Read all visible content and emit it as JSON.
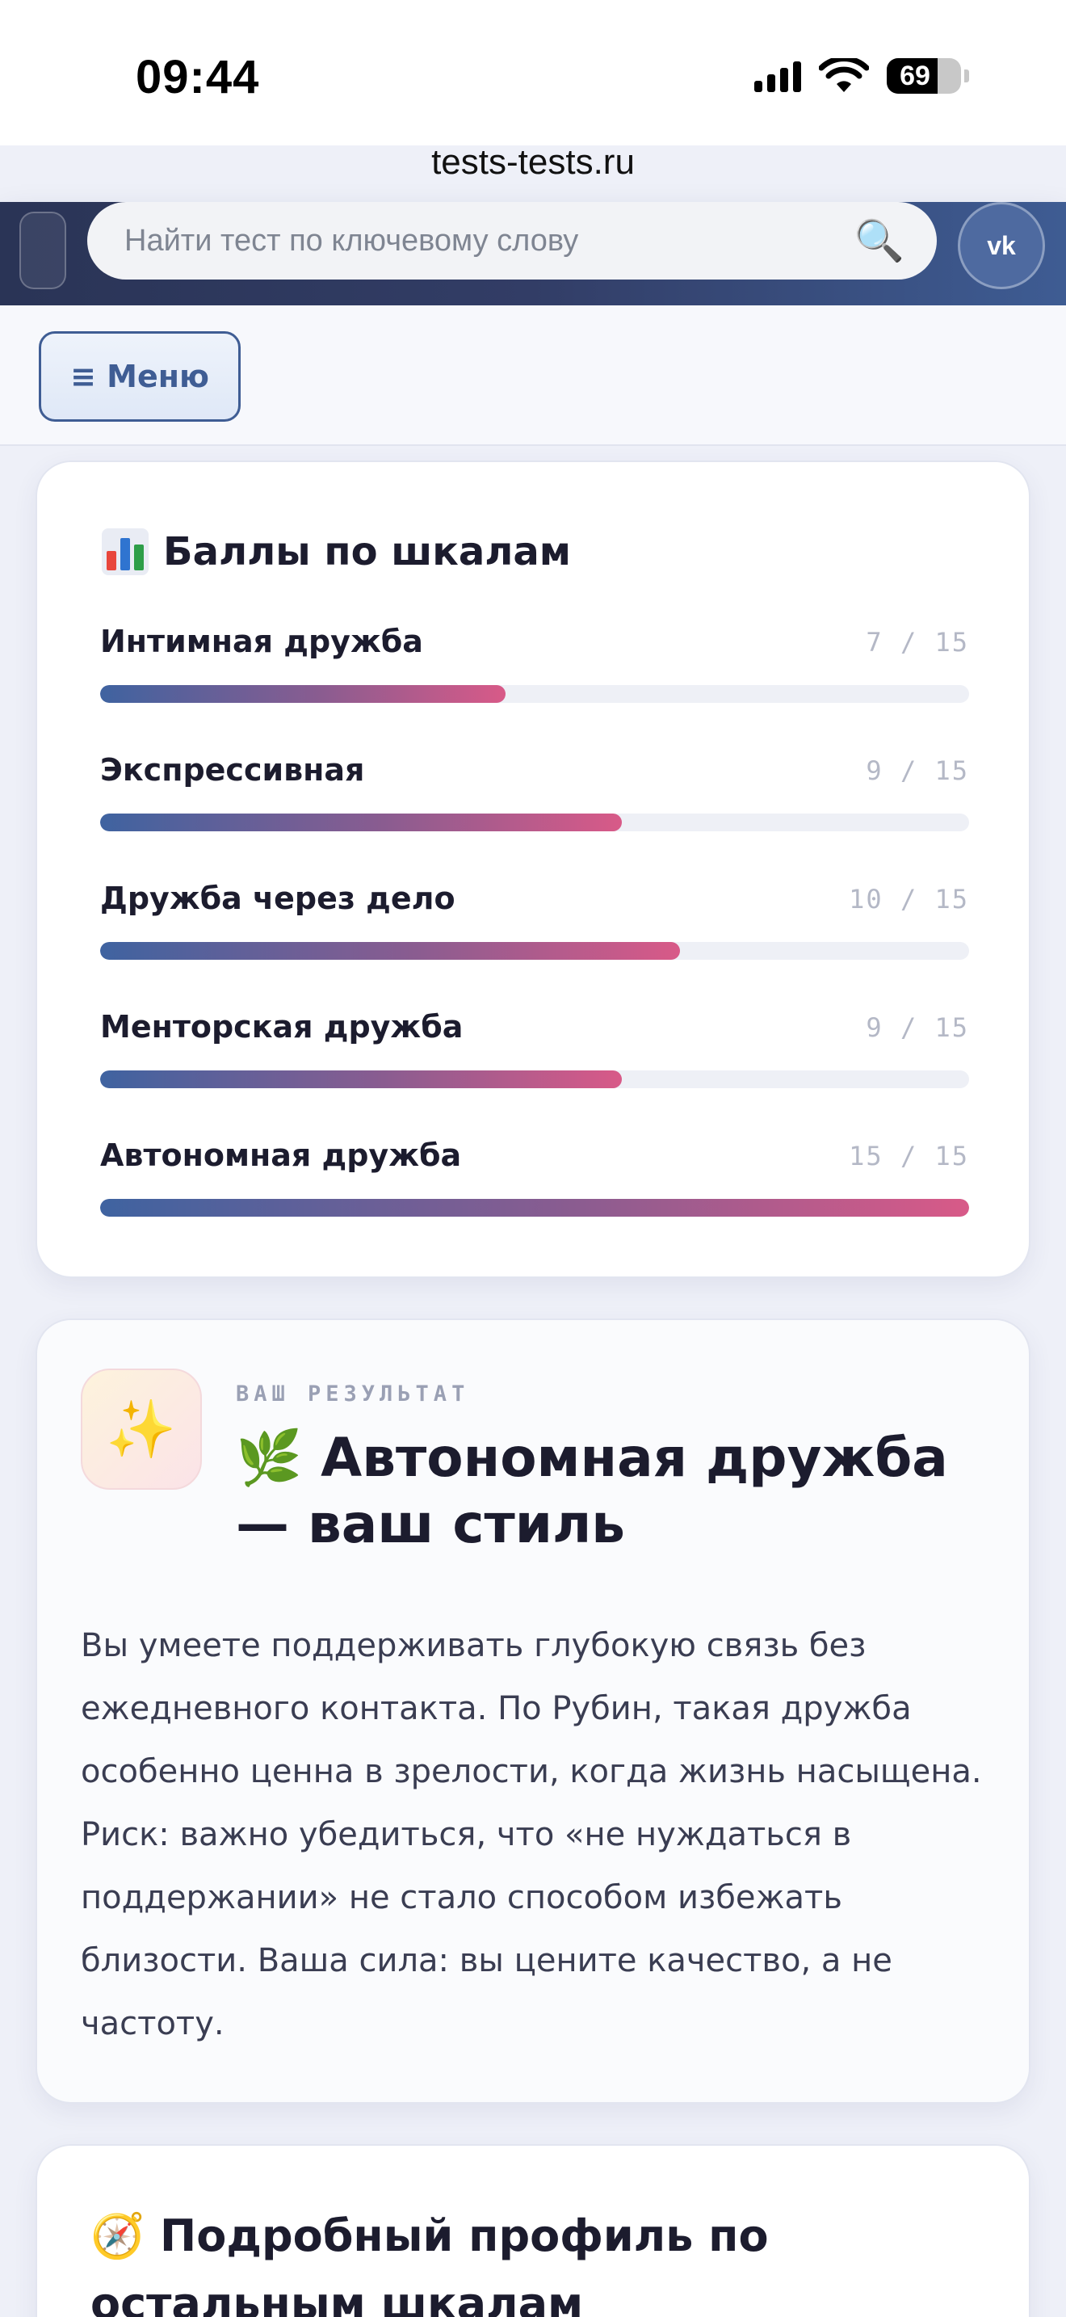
{
  "status_bar": {
    "time": "09:44",
    "battery": "69",
    "signal_icon": "cellular-signal-icon",
    "wifi_icon": "wifi-icon"
  },
  "browser": {
    "url": "tests-tests.ru"
  },
  "header": {
    "search_placeholder": "Найти тест по ключевому слову",
    "search_icon": "magnifier-icon",
    "vk_label": "vk",
    "accent_color": "#2f3a60"
  },
  "menu": {
    "label": "≡ Меню"
  },
  "scores": {
    "title": "Баллы по шкалам",
    "items": [
      {
        "label": "Интимная дружба",
        "value": "7 / 15",
        "fraction": 0.467
      },
      {
        "label": "Экспрессивная",
        "value": "9 / 15",
        "fraction": 0.6
      },
      {
        "label": "Дружба через дело",
        "value": "10 / 15",
        "fraction": 0.667
      },
      {
        "label": "Менторская дружба",
        "value": "9 / 15",
        "fraction": 0.6
      },
      {
        "label": "Автономная дружба",
        "value": "15 / 15",
        "fraction": 1.0
      }
    ]
  },
  "result": {
    "kicker": "ВАШ РЕЗУЛЬТАТ",
    "badge_emoji": "✨",
    "title": "🌿 Автономная дружба — ваш стиль",
    "text": "Вы умеете поддерживать глубокую связь без ежедневного контакта. По Рубин, такая дружба особенно ценна в зрелости, когда жизнь насыщена. Риск: важно убедиться, что «не нуждаться в поддержании» не стало способом избежать близости. Ваша сила: вы цените качество, а не частоту."
  },
  "profile": {
    "title": "🧭 Подробный профиль по остальным шкалам"
  }
}
